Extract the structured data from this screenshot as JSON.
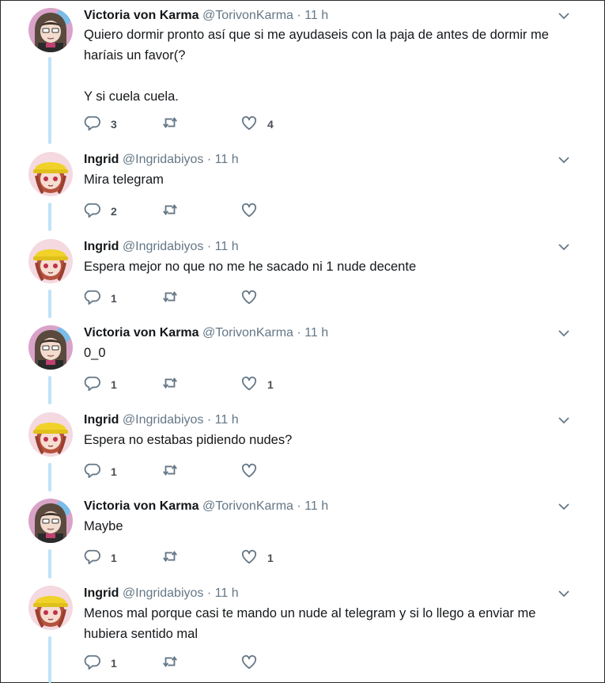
{
  "colors": {
    "thread_line": "#bfe3f7",
    "text": "#14171a",
    "meta": "#657786",
    "icon": "#657786"
  },
  "icons": {
    "reply": "reply-icon",
    "retweet": "retweet-icon",
    "like": "heart-icon",
    "menu": "chevron-down-icon"
  },
  "tweets": [
    {
      "author": "Victoria von Karma",
      "handle": "@TorivonKarma",
      "time": "· 11 h",
      "avatar": "victoria",
      "lines": [
        "Quiero dormir pronto así que si me ayudaseis con la paja de antes de dormir me",
        "haríais un favor(?",
        "",
        "Y si cuela cuela."
      ],
      "replies": "3",
      "retweets": "",
      "likes": "4"
    },
    {
      "author": "Ingrid",
      "handle": "@Ingridabiyos",
      "time": "· 11 h",
      "avatar": "ingrid",
      "lines": [
        "Mira telegram"
      ],
      "replies": "2",
      "retweets": "",
      "likes": ""
    },
    {
      "author": "Ingrid",
      "handle": "@Ingridabiyos",
      "time": "· 11 h",
      "avatar": "ingrid",
      "lines": [
        "Espera mejor no que no me he sacado ni 1 nude decente"
      ],
      "replies": "1",
      "retweets": "",
      "likes": ""
    },
    {
      "author": "Victoria von Karma",
      "handle": "@TorivonKarma",
      "time": "· 11 h",
      "avatar": "victoria",
      "lines": [
        "0_0"
      ],
      "replies": "1",
      "retweets": "",
      "likes": "1"
    },
    {
      "author": "Ingrid",
      "handle": "@Ingridabiyos",
      "time": "· 11 h",
      "avatar": "ingrid",
      "lines": [
        "Espera no estabas pidiendo nudes?"
      ],
      "replies": "1",
      "retweets": "",
      "likes": ""
    },
    {
      "author": "Victoria von Karma",
      "handle": "@TorivonKarma",
      "time": "· 11 h",
      "avatar": "victoria",
      "lines": [
        "Maybe"
      ],
      "replies": "1",
      "retweets": "",
      "likes": "1"
    },
    {
      "author": "Ingrid",
      "handle": "@Ingridabiyos",
      "time": "· 11 h",
      "avatar": "ingrid",
      "lines": [
        "Menos mal porque casi te mando un nude al telegram y si lo llego a enviar me",
        "hubiera sentido mal"
      ],
      "replies": "1",
      "retweets": "",
      "likes": ""
    }
  ]
}
